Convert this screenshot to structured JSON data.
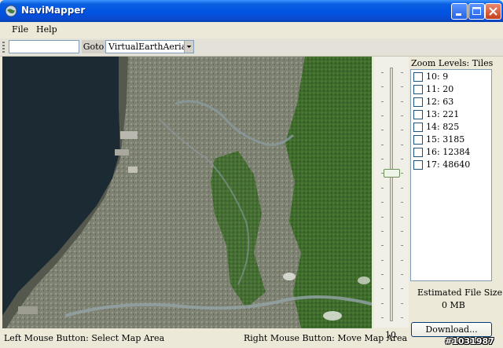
{
  "window": {
    "title": "NaviMapper"
  },
  "menu": {
    "items": [
      {
        "label": "File"
      },
      {
        "label": "Help"
      }
    ]
  },
  "toolbar": {
    "search_value": "",
    "goto_label": "Goto",
    "map_source": "VirtualEarthAerial"
  },
  "slider": {
    "value": "10",
    "level": 10,
    "min": 0,
    "max": 17
  },
  "zoom": {
    "header": "Zoom Levels: Tiles",
    "levels": [
      {
        "label": "10: 9",
        "checked": false
      },
      {
        "label": "11: 20",
        "checked": false
      },
      {
        "label": "12: 63",
        "checked": false
      },
      {
        "label": "13: 221",
        "checked": false
      },
      {
        "label": "14: 825",
        "checked": false
      },
      {
        "label": "15: 3185",
        "checked": false
      },
      {
        "label": "16: 12384",
        "checked": false
      },
      {
        "label": "17: 48640",
        "checked": false
      }
    ]
  },
  "estimate": {
    "label": "Estimated File Size:",
    "value": "0 MB"
  },
  "download": {
    "label": "Download..."
  },
  "status": {
    "left": "Left Mouse Button: Select Map Area",
    "right": "Right Mouse Button: Move Map Area"
  },
  "watermark": "#1031987",
  "colors": {
    "titlebar": "#0054e3",
    "sea": "#1c2a33",
    "land": "#7a8068",
    "forest": "#3f6b2c",
    "river": "#8a9aa0"
  }
}
